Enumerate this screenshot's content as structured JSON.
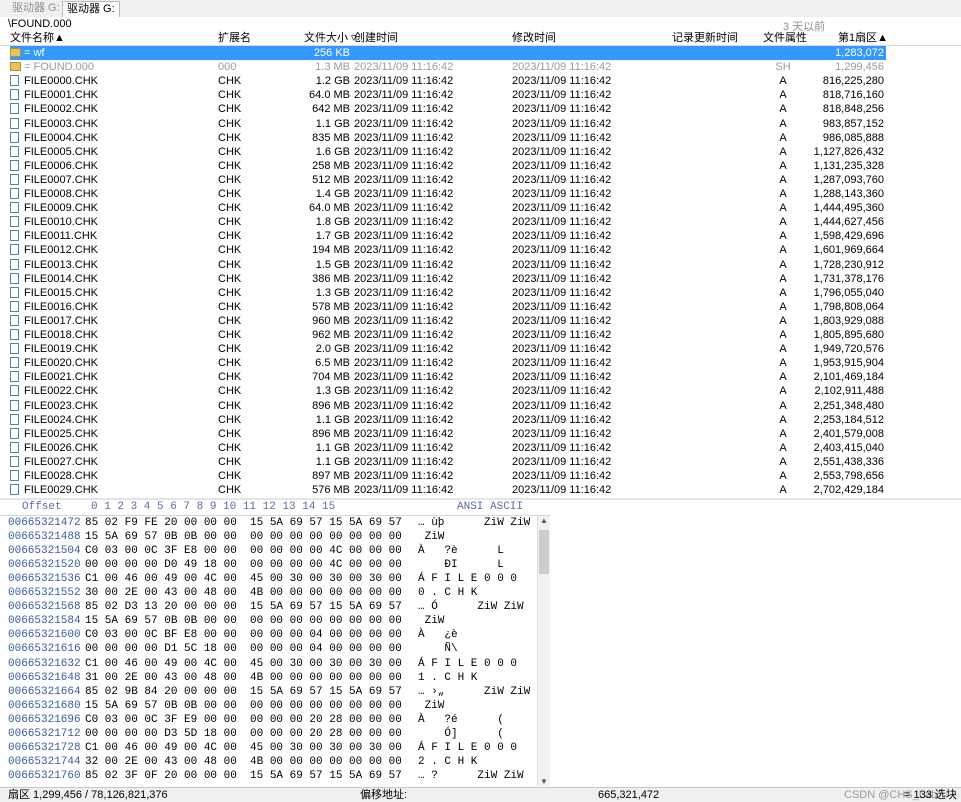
{
  "tabs": [
    "驱动器 G:",
    "驱动器 G:"
  ],
  "path": "\\FOUND.000",
  "path_note": "3 天以前",
  "columns": {
    "name": "文件名称▲",
    "ext": "扩展名",
    "size": "文件大小 ▿",
    "ctime": "创建时间",
    "mtime": "修改时间",
    "rtime": "记录更新时间",
    "attr": "文件属性",
    "sector": "第1扇区▲"
  },
  "rows": [
    {
      "name": "=   wf",
      "ext": "",
      "size": "256 KB",
      "ctime": "",
      "mtime": "",
      "attr": "",
      "sector": "1,283,072",
      "kind": "dir",
      "state": "sel"
    },
    {
      "name": "=   FOUND.000",
      "ext": "000",
      "size": "1.3 MB",
      "ctime": "2023/11/09  11:16:42",
      "mtime": "2023/11/09  11:16:42",
      "attr": "SH",
      "sector": "1,299,456",
      "kind": "dir",
      "state": "grey"
    },
    {
      "name": "FILE0000.CHK",
      "ext": "CHK",
      "size": "1.2 GB",
      "ctime": "2023/11/09  11:16:42",
      "mtime": "2023/11/09  11:16:42",
      "attr": "A",
      "sector": "816,225,280",
      "kind": "file",
      "state": ""
    },
    {
      "name": "FILE0001.CHK",
      "ext": "CHK",
      "size": "64.0 MB",
      "ctime": "2023/11/09  11:16:42",
      "mtime": "2023/11/09  11:16:42",
      "attr": "A",
      "sector": "818,716,160",
      "kind": "file",
      "state": ""
    },
    {
      "name": "FILE0002.CHK",
      "ext": "CHK",
      "size": "642 MB",
      "ctime": "2023/11/09  11:16:42",
      "mtime": "2023/11/09  11:16:42",
      "attr": "A",
      "sector": "818,848,256",
      "kind": "file",
      "state": ""
    },
    {
      "name": "FILE0003.CHK",
      "ext": "CHK",
      "size": "1.1 GB",
      "ctime": "2023/11/09  11:16:42",
      "mtime": "2023/11/09  11:16:42",
      "attr": "A",
      "sector": "983,857,152",
      "kind": "file",
      "state": ""
    },
    {
      "name": "FILE0004.CHK",
      "ext": "CHK",
      "size": "835 MB",
      "ctime": "2023/11/09  11:16:42",
      "mtime": "2023/11/09  11:16:42",
      "attr": "A",
      "sector": "986,085,888",
      "kind": "file",
      "state": ""
    },
    {
      "name": "FILE0005.CHK",
      "ext": "CHK",
      "size": "1.6 GB",
      "ctime": "2023/11/09  11:16:42",
      "mtime": "2023/11/09  11:16:42",
      "attr": "A",
      "sector": "1,127,826,432",
      "kind": "file",
      "state": ""
    },
    {
      "name": "FILE0006.CHK",
      "ext": "CHK",
      "size": "258 MB",
      "ctime": "2023/11/09  11:16:42",
      "mtime": "2023/11/09  11:16:42",
      "attr": "A",
      "sector": "1,131,235,328",
      "kind": "file",
      "state": ""
    },
    {
      "name": "FILE0007.CHK",
      "ext": "CHK",
      "size": "512 MB",
      "ctime": "2023/11/09  11:16:42",
      "mtime": "2023/11/09  11:16:42",
      "attr": "A",
      "sector": "1,287,093,760",
      "kind": "file",
      "state": ""
    },
    {
      "name": "FILE0008.CHK",
      "ext": "CHK",
      "size": "1.4 GB",
      "ctime": "2023/11/09  11:16:42",
      "mtime": "2023/11/09  11:16:42",
      "attr": "A",
      "sector": "1,288,143,360",
      "kind": "file",
      "state": ""
    },
    {
      "name": "FILE0009.CHK",
      "ext": "CHK",
      "size": "64.0 MB",
      "ctime": "2023/11/09  11:16:42",
      "mtime": "2023/11/09  11:16:42",
      "attr": "A",
      "sector": "1,444,495,360",
      "kind": "file",
      "state": ""
    },
    {
      "name": "FILE0010.CHK",
      "ext": "CHK",
      "size": "1.8 GB",
      "ctime": "2023/11/09  11:16:42",
      "mtime": "2023/11/09  11:16:42",
      "attr": "A",
      "sector": "1,444,627,456",
      "kind": "file",
      "state": ""
    },
    {
      "name": "FILE0011.CHK",
      "ext": "CHK",
      "size": "1.7 GB",
      "ctime": "2023/11/09  11:16:42",
      "mtime": "2023/11/09  11:16:42",
      "attr": "A",
      "sector": "1,598,429,696",
      "kind": "file",
      "state": ""
    },
    {
      "name": "FILE0012.CHK",
      "ext": "CHK",
      "size": "194 MB",
      "ctime": "2023/11/09  11:16:42",
      "mtime": "2023/11/09  11:16:42",
      "attr": "A",
      "sector": "1,601,969,664",
      "kind": "file",
      "state": ""
    },
    {
      "name": "FILE0013.CHK",
      "ext": "CHK",
      "size": "1.5 GB",
      "ctime": "2023/11/09  11:16:42",
      "mtime": "2023/11/09  11:16:42",
      "attr": "A",
      "sector": "1,728,230,912",
      "kind": "file",
      "state": ""
    },
    {
      "name": "FILE0014.CHK",
      "ext": "CHK",
      "size": "386 MB",
      "ctime": "2023/11/09  11:16:42",
      "mtime": "2023/11/09  11:16:42",
      "attr": "A",
      "sector": "1,731,378,176",
      "kind": "file",
      "state": ""
    },
    {
      "name": "FILE0015.CHK",
      "ext": "CHK",
      "size": "1.3 GB",
      "ctime": "2023/11/09  11:16:42",
      "mtime": "2023/11/09  11:16:42",
      "attr": "A",
      "sector": "1,796,055,040",
      "kind": "file",
      "state": ""
    },
    {
      "name": "FILE0016.CHK",
      "ext": "CHK",
      "size": "578 MB",
      "ctime": "2023/11/09  11:16:42",
      "mtime": "2023/11/09  11:16:42",
      "attr": "A",
      "sector": "1,798,808,064",
      "kind": "file",
      "state": ""
    },
    {
      "name": "FILE0017.CHK",
      "ext": "CHK",
      "size": "960 MB",
      "ctime": "2023/11/09  11:16:42",
      "mtime": "2023/11/09  11:16:42",
      "attr": "A",
      "sector": "1,803,929,088",
      "kind": "file",
      "state": ""
    },
    {
      "name": "FILE0018.CHK",
      "ext": "CHK",
      "size": "962 MB",
      "ctime": "2023/11/09  11:16:42",
      "mtime": "2023/11/09  11:16:42",
      "attr": "A",
      "sector": "1,805,895,680",
      "kind": "file",
      "state": ""
    },
    {
      "name": "FILE0019.CHK",
      "ext": "CHK",
      "size": "2.0 GB",
      "ctime": "2023/11/09  11:16:42",
      "mtime": "2023/11/09  11:16:42",
      "attr": "A",
      "sector": "1,949,720,576",
      "kind": "file",
      "state": ""
    },
    {
      "name": "FILE0020.CHK",
      "ext": "CHK",
      "size": "6.5 MB",
      "ctime": "2023/11/09  11:16:42",
      "mtime": "2023/11/09  11:16:42",
      "attr": "A",
      "sector": "1,953,915,904",
      "kind": "file",
      "state": ""
    },
    {
      "name": "FILE0021.CHK",
      "ext": "CHK",
      "size": "704 MB",
      "ctime": "2023/11/09  11:16:42",
      "mtime": "2023/11/09  11:16:42",
      "attr": "A",
      "sector": "2,101,469,184",
      "kind": "file",
      "state": ""
    },
    {
      "name": "FILE0022.CHK",
      "ext": "CHK",
      "size": "1.3 GB",
      "ctime": "2023/11/09  11:16:42",
      "mtime": "2023/11/09  11:16:42",
      "attr": "A",
      "sector": "2,102,911,488",
      "kind": "file",
      "state": ""
    },
    {
      "name": "FILE0023.CHK",
      "ext": "CHK",
      "size": "896 MB",
      "ctime": "2023/11/09  11:16:42",
      "mtime": "2023/11/09  11:16:42",
      "attr": "A",
      "sector": "2,251,348,480",
      "kind": "file",
      "state": ""
    },
    {
      "name": "FILE0024.CHK",
      "ext": "CHK",
      "size": "1.1 GB",
      "ctime": "2023/11/09  11:16:42",
      "mtime": "2023/11/09  11:16:42",
      "attr": "A",
      "sector": "2,253,184,512",
      "kind": "file",
      "state": ""
    },
    {
      "name": "FILE0025.CHK",
      "ext": "CHK",
      "size": "896 MB",
      "ctime": "2023/11/09  11:16:42",
      "mtime": "2023/11/09  11:16:42",
      "attr": "A",
      "sector": "2,401,579,008",
      "kind": "file",
      "state": ""
    },
    {
      "name": "FILE0026.CHK",
      "ext": "CHK",
      "size": "1.1 GB",
      "ctime": "2023/11/09  11:16:42",
      "mtime": "2023/11/09  11:16:42",
      "attr": "A",
      "sector": "2,403,415,040",
      "kind": "file",
      "state": ""
    },
    {
      "name": "FILE0027.CHK",
      "ext": "CHK",
      "size": "1.1 GB",
      "ctime": "2023/11/09  11:16:42",
      "mtime": "2023/11/09  11:16:42",
      "attr": "A",
      "sector": "2,551,438,336",
      "kind": "file",
      "state": ""
    },
    {
      "name": "FILE0028.CHK",
      "ext": "CHK",
      "size": "897 MB",
      "ctime": "2023/11/09  11:16:42",
      "mtime": "2023/11/09  11:16:42",
      "attr": "A",
      "sector": "2,553,798,656",
      "kind": "file",
      "state": ""
    },
    {
      "name": "FILE0029.CHK",
      "ext": "CHK",
      "size": "576 MB",
      "ctime": "2023/11/09  11:16:42",
      "mtime": "2023/11/09  11:16:42",
      "attr": "A",
      "sector": "2,702,429,184",
      "kind": "file",
      "state": ""
    }
  ],
  "hex": {
    "offset_label": "Offset",
    "col_headers": "0  1  2  3  4  5  6  7   8  9 10 11 12 13 14 15",
    "ascii_label": "ANSI ASCII",
    "rows": [
      {
        "off": "00665321472",
        "hex": "85 02 F9 FE 20 00 00 00  15 5A 69 57 15 5A 69 57",
        "asc": "… ùþ      ZiW ZiW"
      },
      {
        "off": "00665321488",
        "hex": "15 5A 69 57 0B 0B 00 00  00 00 00 00 00 00 00 00",
        "asc": " ZiW"
      },
      {
        "off": "00665321504",
        "hex": "C0 03 00 0C 3F E8 00 00  00 00 00 00 4C 00 00 00",
        "asc": "À   ?è      L"
      },
      {
        "off": "00665321520",
        "hex": "00 00 00 00 D0 49 18 00  00 00 00 00 4C 00 00 00",
        "asc": "    ÐI      L"
      },
      {
        "off": "00665321536",
        "hex": "C1 00 46 00 49 00 4C 00  45 00 30 00 30 00 30 00",
        "asc": "Á F I L E 0 0 0"
      },
      {
        "off": "00665321552",
        "hex": "30 00 2E 00 43 00 48 00  4B 00 00 00 00 00 00 00",
        "asc": "0 . C H K"
      },
      {
        "off": "00665321568",
        "hex": "85 02 D3 13 20 00 00 00  15 5A 69 57 15 5A 69 57",
        "asc": "… Ó      ZiW ZiW"
      },
      {
        "off": "00665321584",
        "hex": "15 5A 69 57 0B 0B 00 00  00 00 00 00 00 00 00 00",
        "asc": " ZiW"
      },
      {
        "off": "00665321600",
        "hex": "C0 03 00 0C BF E8 00 00  00 00 00 04 00 00 00 00",
        "asc": "À   ¿è"
      },
      {
        "off": "00665321616",
        "hex": "00 00 00 00 D1 5C 18 00  00 00 00 04 00 00 00 00",
        "asc": "    Ñ\\"
      },
      {
        "off": "00665321632",
        "hex": "C1 00 46 00 49 00 4C 00  45 00 30 00 30 00 30 00",
        "asc": "Á F I L E 0 0 0"
      },
      {
        "off": "00665321648",
        "hex": "31 00 2E 00 43 00 48 00  4B 00 00 00 00 00 00 00",
        "asc": "1 . C H K"
      },
      {
        "off": "00665321664",
        "hex": "85 02 9B 84 20 00 00 00  15 5A 69 57 15 5A 69 57",
        "asc": "… ›„      ZiW ZiW"
      },
      {
        "off": "00665321680",
        "hex": "15 5A 69 57 0B 0B 00 00  00 00 00 00 00 00 00 00",
        "asc": " ZiW"
      },
      {
        "off": "00665321696",
        "hex": "C0 03 00 0C 3F E9 00 00  00 00 00 20 28 00 00 00",
        "asc": "À   ?é      ("
      },
      {
        "off": "00665321712",
        "hex": "00 00 00 00 D3 5D 18 00  00 00 00 20 28 00 00 00",
        "asc": "    Ó]      ("
      },
      {
        "off": "00665321728",
        "hex": "C1 00 46 00 49 00 4C 00  45 00 30 00 30 00 30 00",
        "asc": "Á F I L E 0 0 0"
      },
      {
        "off": "00665321744",
        "hex": "32 00 2E 00 43 00 48 00  4B 00 00 00 00 00 00 00",
        "asc": "2 . C H K"
      },
      {
        "off": "00665321760",
        "hex": "85 02 3F 0F 20 00 00 00  15 5A 69 57 15 5A 69 57",
        "asc": "… ?      ZiW ZiW"
      }
    ]
  },
  "status": {
    "sector": "扇区 1,299,456 / 78,126,821,376",
    "offset_label": "偏移地址:",
    "offset_value": "665,321,472",
    "selection": "= 133  选块",
    "watermark": "CSDN @CHS_Lab"
  }
}
